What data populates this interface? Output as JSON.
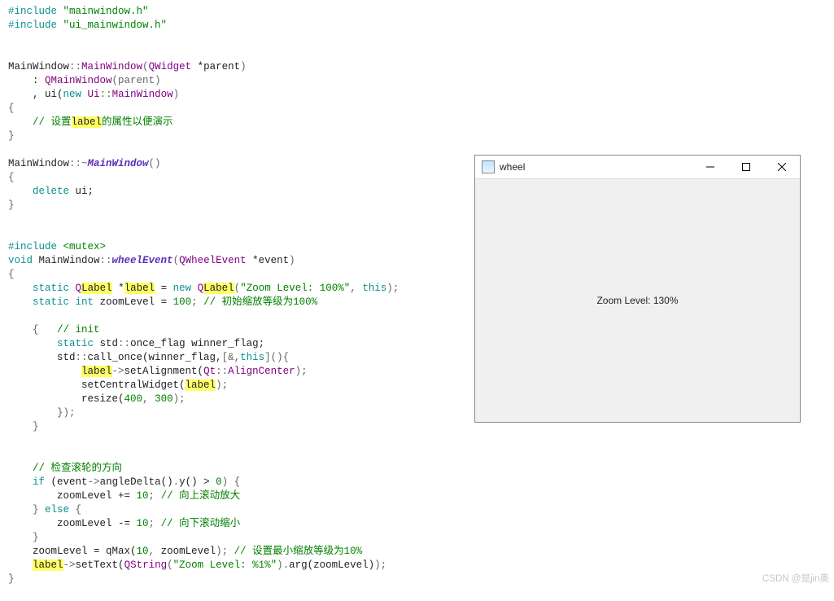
{
  "code": {
    "lines": [
      [
        {
          "cls": "k",
          "t": "#include"
        },
        {
          "cls": "",
          "t": " "
        },
        {
          "cls": "s",
          "t": "\"mainwindow.h\""
        }
      ],
      [
        {
          "cls": "k",
          "t": "#include"
        },
        {
          "cls": "",
          "t": " "
        },
        {
          "cls": "s",
          "t": "\"ui_mainwindow.h\""
        }
      ],
      [],
      [],
      [
        {
          "cls": "",
          "t": "MainWindow"
        },
        {
          "cls": "m",
          "t": "::"
        },
        {
          "cls": "t",
          "t": "MainWindow"
        },
        {
          "cls": "m",
          "t": "("
        },
        {
          "cls": "t",
          "t": "QWidget"
        },
        {
          "cls": "",
          "t": " *parent"
        },
        {
          "cls": "m",
          "t": ")"
        }
      ],
      [
        {
          "cls": "",
          "t": "    : "
        },
        {
          "cls": "t",
          "t": "QMainWindow"
        },
        {
          "cls": "m",
          "t": "(parent)"
        }
      ],
      [
        {
          "cls": "",
          "t": "    , ui("
        },
        {
          "cls": "k",
          "t": "new"
        },
        {
          "cls": "",
          "t": " "
        },
        {
          "cls": "t",
          "t": "Ui"
        },
        {
          "cls": "m",
          "t": "::"
        },
        {
          "cls": "t",
          "t": "MainWindow"
        },
        {
          "cls": "m",
          "t": ")"
        }
      ],
      [
        {
          "cls": "m",
          "t": "{"
        }
      ],
      [
        {
          "cls": "",
          "t": "    "
        },
        {
          "cls": "c",
          "t": "// 设置"
        },
        {
          "cls": "hl",
          "t": "label"
        },
        {
          "cls": "c",
          "t": "的属性以便演示"
        }
      ],
      [
        {
          "cls": "m",
          "t": "}"
        }
      ],
      [],
      [
        {
          "cls": "",
          "t": "MainWindow"
        },
        {
          "cls": "m",
          "t": "::~"
        },
        {
          "cls": "f",
          "t": "MainWindow"
        },
        {
          "cls": "m",
          "t": "()"
        }
      ],
      [
        {
          "cls": "m",
          "t": "{"
        }
      ],
      [
        {
          "cls": "",
          "t": "    "
        },
        {
          "cls": "k",
          "t": "delete"
        },
        {
          "cls": "",
          "t": " ui;"
        }
      ],
      [
        {
          "cls": "m",
          "t": "}"
        }
      ],
      [],
      [],
      [
        {
          "cls": "k",
          "t": "#include"
        },
        {
          "cls": "",
          "t": " "
        },
        {
          "cls": "s",
          "t": "<mutex>"
        }
      ],
      [
        {
          "cls": "k",
          "t": "void"
        },
        {
          "cls": "",
          "t": " MainWindow"
        },
        {
          "cls": "m",
          "t": "::"
        },
        {
          "cls": "f",
          "t": "wheelEvent"
        },
        {
          "cls": "m",
          "t": "("
        },
        {
          "cls": "t",
          "t": "QWheelEvent"
        },
        {
          "cls": "",
          "t": " *event"
        },
        {
          "cls": "m",
          "t": ")"
        }
      ],
      [
        {
          "cls": "m",
          "t": "{"
        }
      ],
      [
        {
          "cls": "",
          "t": "    "
        },
        {
          "cls": "k",
          "t": "static"
        },
        {
          "cls": "",
          "t": " "
        },
        {
          "cls": "t",
          "t": "Q"
        },
        {
          "cls": "hl",
          "t": "Label"
        },
        {
          "cls": "",
          "t": " *"
        },
        {
          "cls": "hl",
          "t": "label"
        },
        {
          "cls": "",
          "t": " = "
        },
        {
          "cls": "k",
          "t": "new"
        },
        {
          "cls": "",
          "t": " "
        },
        {
          "cls": "t",
          "t": "Q"
        },
        {
          "cls": "hl",
          "t": "Label"
        },
        {
          "cls": "m",
          "t": "("
        },
        {
          "cls": "s",
          "t": "\"Zoom Level: 100%\""
        },
        {
          "cls": "m",
          "t": ", "
        },
        {
          "cls": "k",
          "t": "this"
        },
        {
          "cls": "m",
          "t": ");"
        }
      ],
      [
        {
          "cls": "",
          "t": "    "
        },
        {
          "cls": "k",
          "t": "static"
        },
        {
          "cls": "",
          "t": " "
        },
        {
          "cls": "k",
          "t": "int"
        },
        {
          "cls": "",
          "t": " zoomLevel = "
        },
        {
          "cls": "n",
          "t": "100"
        },
        {
          "cls": "m",
          "t": "; "
        },
        {
          "cls": "c",
          "t": "// 初始缩放等级为100%"
        }
      ],
      [],
      [
        {
          "cls": "",
          "t": "    "
        },
        {
          "cls": "m",
          "t": "{   "
        },
        {
          "cls": "c",
          "t": "// init"
        }
      ],
      [
        {
          "cls": "",
          "t": "        "
        },
        {
          "cls": "k",
          "t": "static"
        },
        {
          "cls": "",
          "t": " std"
        },
        {
          "cls": "m",
          "t": "::"
        },
        {
          "cls": "",
          "t": "once_flag winner_flag;"
        }
      ],
      [
        {
          "cls": "",
          "t": "        std"
        },
        {
          "cls": "m",
          "t": "::"
        },
        {
          "cls": "",
          "t": "call_once(winner_flag,"
        },
        {
          "cls": "m",
          "t": "[&,"
        },
        {
          "cls": "k",
          "t": "this"
        },
        {
          "cls": "m",
          "t": "](){"
        }
      ],
      [
        {
          "cls": "",
          "t": "            "
        },
        {
          "cls": "hl",
          "t": "label"
        },
        {
          "cls": "m",
          "t": "->"
        },
        {
          "cls": "",
          "t": "setAlignment("
        },
        {
          "cls": "t",
          "t": "Qt"
        },
        {
          "cls": "m",
          "t": "::"
        },
        {
          "cls": "t",
          "t": "AlignCenter"
        },
        {
          "cls": "m",
          "t": ");"
        }
      ],
      [
        {
          "cls": "",
          "t": "            setCentralWidget("
        },
        {
          "cls": "hl",
          "t": "label"
        },
        {
          "cls": "m",
          "t": ");"
        }
      ],
      [
        {
          "cls": "",
          "t": "            resize("
        },
        {
          "cls": "n",
          "t": "400"
        },
        {
          "cls": "m",
          "t": ", "
        },
        {
          "cls": "n",
          "t": "300"
        },
        {
          "cls": "m",
          "t": ");"
        }
      ],
      [
        {
          "cls": "",
          "t": "        "
        },
        {
          "cls": "m",
          "t": "});"
        }
      ],
      [
        {
          "cls": "",
          "t": "    "
        },
        {
          "cls": "m",
          "t": "}"
        }
      ],
      [],
      [],
      [
        {
          "cls": "",
          "t": "    "
        },
        {
          "cls": "c",
          "t": "// 检查滚轮的方向"
        }
      ],
      [
        {
          "cls": "",
          "t": "    "
        },
        {
          "cls": "k",
          "t": "if"
        },
        {
          "cls": "",
          "t": " (event"
        },
        {
          "cls": "m",
          "t": "->"
        },
        {
          "cls": "",
          "t": "angleDelta()"
        },
        {
          "cls": "m",
          "t": "."
        },
        {
          "cls": "",
          "t": "y() > "
        },
        {
          "cls": "n",
          "t": "0"
        },
        {
          "cls": "m",
          "t": ") {"
        }
      ],
      [
        {
          "cls": "",
          "t": "        zoomLevel += "
        },
        {
          "cls": "n",
          "t": "10"
        },
        {
          "cls": "m",
          "t": "; "
        },
        {
          "cls": "c",
          "t": "// 向上滚动放大"
        }
      ],
      [
        {
          "cls": "",
          "t": "    "
        },
        {
          "cls": "m",
          "t": "} "
        },
        {
          "cls": "k",
          "t": "else"
        },
        {
          "cls": "m",
          "t": " {"
        }
      ],
      [
        {
          "cls": "",
          "t": "        zoomLevel -= "
        },
        {
          "cls": "n",
          "t": "10"
        },
        {
          "cls": "m",
          "t": "; "
        },
        {
          "cls": "c",
          "t": "// 向下滚动缩小"
        }
      ],
      [
        {
          "cls": "",
          "t": "    "
        },
        {
          "cls": "m",
          "t": "}"
        }
      ],
      [
        {
          "cls": "",
          "t": "    zoomLevel = qMax("
        },
        {
          "cls": "n",
          "t": "10"
        },
        {
          "cls": "m",
          "t": ", "
        },
        {
          "cls": "",
          "t": "zoomLevel"
        },
        {
          "cls": "m",
          "t": "); "
        },
        {
          "cls": "c",
          "t": "// 设置最小缩放等级为10%"
        }
      ],
      [
        {
          "cls": "",
          "t": "    "
        },
        {
          "cls": "hl",
          "t": "label"
        },
        {
          "cls": "m",
          "t": "->"
        },
        {
          "cls": "",
          "t": "setText("
        },
        {
          "cls": "t",
          "t": "QString"
        },
        {
          "cls": "m",
          "t": "("
        },
        {
          "cls": "s",
          "t": "\"Zoom Level: %1%\""
        },
        {
          "cls": "m",
          "t": ")."
        },
        {
          "cls": "",
          "t": "arg(zoomLevel)"
        },
        {
          "cls": "m",
          "t": ");"
        }
      ],
      [
        {
          "cls": "m",
          "t": "}"
        }
      ]
    ]
  },
  "window": {
    "title": "wheel",
    "content": "Zoom Level: 130%"
  },
  "watermark": "CSDN @是jin奥"
}
